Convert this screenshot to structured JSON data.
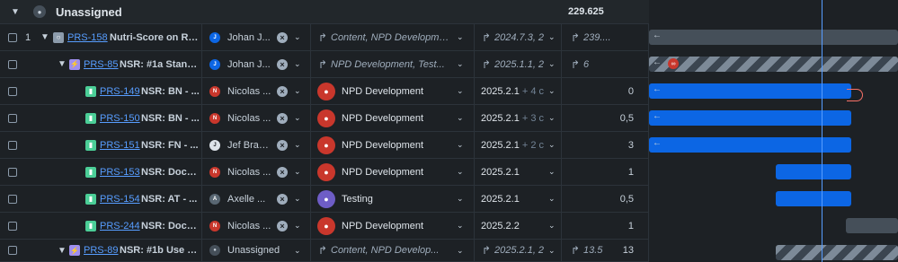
{
  "group": {
    "title": "Unassigned",
    "total": "229.625"
  },
  "rows": [
    {
      "num": "1",
      "key": "PRS-158",
      "summary": "Nutri-Score on Re...",
      "assignee": "Johan J...",
      "team_rollup": "Content, NPD Development, ...",
      "date_rollup": "2024.7.3, 2",
      "est_rollup": "239...."
    },
    {
      "key": "PRS-85",
      "summary": "NSR: #1a Stand...",
      "assignee": "Johan J...",
      "team_rollup": "NPD Development, Test...",
      "date_rollup": "2025.1.1, 2",
      "est_rollup": "6"
    },
    {
      "key": "PRS-149",
      "summary": "NSR: BN - ...",
      "assignee": "Nicolas ...",
      "team": "NPD Development",
      "date": "2025.2.1",
      "date_extra": "+ 4 c",
      "estimate": "0"
    },
    {
      "key": "PRS-150",
      "summary": "NSR: BN - ...",
      "assignee": "Nicolas ...",
      "team": "NPD Development",
      "date": "2025.2.1",
      "date_extra": "+ 3 c",
      "estimate": "0,5"
    },
    {
      "key": "PRS-151",
      "summary": "NSR: FN - ...",
      "assignee": "Jef Braem",
      "team": "NPD Development",
      "date": "2025.2.1",
      "date_extra": "+ 2 c",
      "estimate": "3"
    },
    {
      "key": "PRS-153",
      "summary": "NSR: Docu...",
      "assignee": "Nicolas ...",
      "team": "NPD Development",
      "date": "2025.2.1",
      "estimate": "1"
    },
    {
      "key": "PRS-154",
      "summary": "NSR: AT - ...",
      "assignee": "Axelle ...",
      "team": "Testing",
      "date": "2025.2.1",
      "estimate": "0,5"
    },
    {
      "key": "PRS-244",
      "summary": "NSR: Docu...",
      "assignee": "Nicolas ...",
      "team": "NPD Development",
      "date": "2025.2.2",
      "estimate": "1"
    },
    {
      "key": "PRS-89",
      "summary": "NSR: #1b Use st...",
      "assignee": "Unassigned",
      "team_rollup": "Content, NPD Develop...",
      "date_rollup": "2025.2.1, 2",
      "est_rollup": "13.5",
      "estimate": "13"
    }
  ],
  "colors": {
    "accent": "#0c66e4",
    "today": "#579dff",
    "team_npd": "#c9372c",
    "team_testing": "#6e5dc6"
  }
}
